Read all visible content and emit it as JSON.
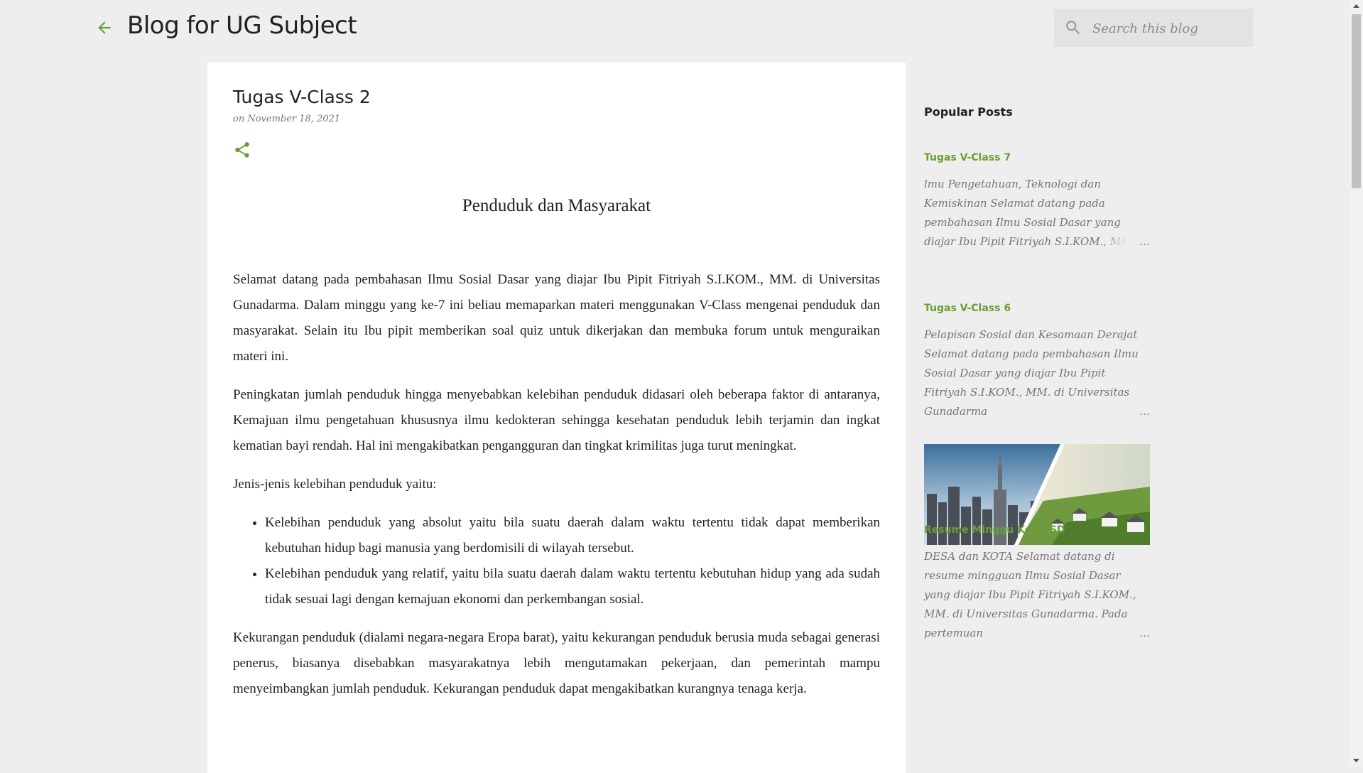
{
  "header": {
    "blog_title": "Blog for UG Subject",
    "search_placeholder": "Search this blog"
  },
  "post": {
    "title": "Tugas V-Class 2",
    "date": "on November 18, 2021",
    "heading": "Penduduk dan Masyarakat",
    "paragraphs": [
      "Selamat datang pada pembahasan Ilmu Sosial Dasar yang diajar Ibu Pipit Fitriyah S.I.KOM., MM. di Universitas Gunadarma. Dalam minggu yang ke-7 ini beliau memaparkan materi menggunakan V-Class mengenai penduduk dan masyarakat. Selain itu Ibu pipit memberikan soal quiz untuk dikerjakan dan membuka forum untuk menguraikan materi ini.",
      "Peningkatan jumlah penduduk hingga menyebabkan kelebihan penduduk didasari oleh beberapa faktor di antaranya, Kemajuan ilmu pengetahuan khususnya ilmu kedokteran sehingga kesehatan penduduk lebih terjamin dan ingkat kematian bayi rendah. Hal ini mengakibatkan pengangguran dan tingkat krimilitas juga turut meningkat.",
      "Jenis-jenis kelebihan penduduk yaitu:"
    ],
    "list": [
      "Kelebihan penduduk yang absolut yaitu bila suatu daerah dalam waktu tertentu tidak dapat memberikan kebutuhan hidup bagi manusia yang berdomisili di wilayah tersebut.",
      "Kelebihan penduduk yang relatif, yaitu bila suatu daerah dalam waktu tertentu kebutuhan hidup yang ada sudah tidak sesuai lagi dengan kemajuan ekonomi dan perkembangan sosial."
    ],
    "paragraph_after": "Kekurangan penduduk (dialami negara-negara Eropa barat), yaitu kekurangan penduduk berusia muda sebagai generasi penerus, biasanya disebabkan masyarakatnya lebih mengutamakan pekerjaan, dan pemerintah mampu menyeimbangkan jumlah penduduk. Kekurangan penduduk dapat mengakibatkan kurangnya tenaga kerja."
  },
  "sidebar": {
    "widget_title": "Popular Posts",
    "posts": [
      {
        "title": "Tugas V-Class 7",
        "snippet": "lmu Pengetahuan, Teknologi dan Kemiskinan Selamat datang pada pembahasan Ilmu Sosial Dasar yang diajar Ibu Pipit Fitriyah S.I.KOM., MM. di",
        "ellipsis": "…"
      },
      {
        "title": "Tugas V-Class 6",
        "snippet": "Pelapisan Sosial dan Kesamaan Derajat Selamat datang pada pembahasan Ilmu Sosial Dasar yang diajar Ibu Pipit Fitriyah S.I.KOM., MM. di Universitas Gunadarma",
        "ellipsis": "…"
      },
      {
        "title": "Resume Minggu Ke-5 ISD",
        "snippet": "DESA dan KOTA Selamat datang di resume mingguan Ilmu Sosial Dasar yang diajar Ibu Pipit Fitriyah S.I.KOM., MM. di Universitas Gunadarma. Pada pertemuan",
        "ellipsis": "…"
      }
    ]
  },
  "colors": {
    "accent": "#689f38",
    "header_bg": "#eeeeee",
    "card_bg": "#ffffff",
    "text": "#212121",
    "muted": "#757575"
  },
  "icons": [
    "back-arrow-icon",
    "search-icon",
    "share-icon"
  ]
}
